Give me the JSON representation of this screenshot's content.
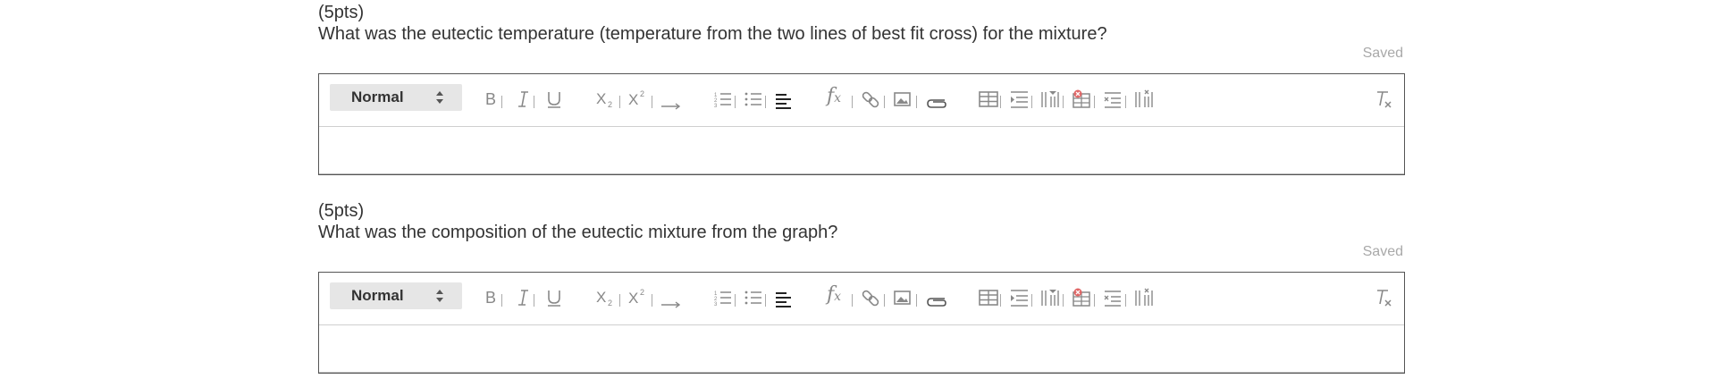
{
  "questions": [
    {
      "points": "(5pts)",
      "prompt": "What was the eutectic temperature (temperature from the two lines of best fit cross) for the mixture?",
      "status": "Saved",
      "format_value": "Normal"
    },
    {
      "points": "(5pts)",
      "prompt": "What was the composition of the eutectic mixture from the graph?",
      "status": "Saved",
      "format_value": "Normal"
    }
  ],
  "toolbar_icons": [
    "bold-icon",
    "italic-icon",
    "underline-icon",
    "subscript-icon",
    "superscript-icon",
    "arrow-icon",
    "ordered-list-icon",
    "bullet-list-icon",
    "align-left-icon",
    "formula-icon",
    "link-icon",
    "image-icon",
    "attachment-icon",
    "table-icon",
    "insert-row-icon",
    "insert-column-icon",
    "delete-table-icon",
    "delete-row-icon",
    "delete-column-icon",
    "clear-format-icon"
  ],
  "colors": {
    "text": "#333333",
    "saved": "#a9a9a9",
    "icon": "#888888",
    "border": "#555555",
    "select_bg": "#e6e6e6"
  }
}
